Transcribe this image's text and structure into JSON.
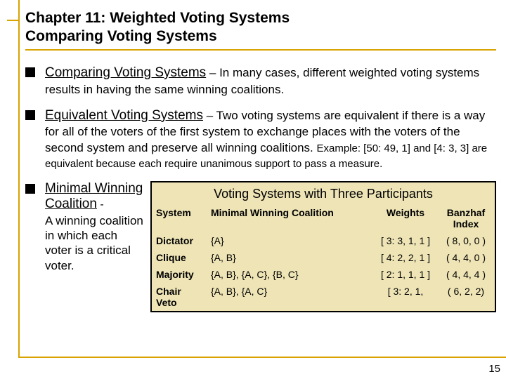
{
  "title": {
    "line1": "Chapter 11:  Weighted Voting Systems",
    "line2": "Comparing Voting Systems"
  },
  "bullets": {
    "b1": {
      "lead": "Comparing Voting Systems",
      "tail": " – In many cases, different weighted voting systems results in having the same winning coalitions."
    },
    "b2": {
      "lead": "Equivalent Voting Systems",
      "tail": " – Two voting systems are equivalent if there is a way for all of the voters of the first system to exchange places with the voters of the second system and preserve all winning coalitions.   ",
      "example": "Example: [50: 49, 1] and [4: 3, 3] are equivalent because each require unanimous support to pass a measure."
    },
    "b3": {
      "lead": "Minimal Winning Coalition",
      "dash": " - ",
      "desc": "A winning coalition in which each voter is a critical voter."
    }
  },
  "table": {
    "title": "Voting Systems with Three Participants",
    "headers": {
      "system": "System",
      "mwc": "Minimal Winning Coalition",
      "weights": "Weights",
      "banzhaf": "Banzhaf Index"
    },
    "rows": [
      {
        "system": "Dictator",
        "mwc": "{A}",
        "weights": "[ 3:  3, 1, 1 ]",
        "banzhaf": "( 8, 0, 0 )"
      },
      {
        "system": "Clique",
        "mwc": "{A, B}",
        "weights": "[ 4:  2, 2, 1 ]",
        "banzhaf": "( 4, 4, 0 )"
      },
      {
        "system": "Majority",
        "mwc": "{A, B}, {A, C}, {B, C}",
        "weights": "[ 2:  1, 1, 1 ]",
        "banzhaf": "( 4, 4, 4 )"
      },
      {
        "system": "Chair Veto",
        "mwc": "{A, B}, {A, C}",
        "weights": "[ 3:  2, 1,",
        "banzhaf": "( 6, 2, 2)"
      }
    ]
  },
  "page": "15"
}
